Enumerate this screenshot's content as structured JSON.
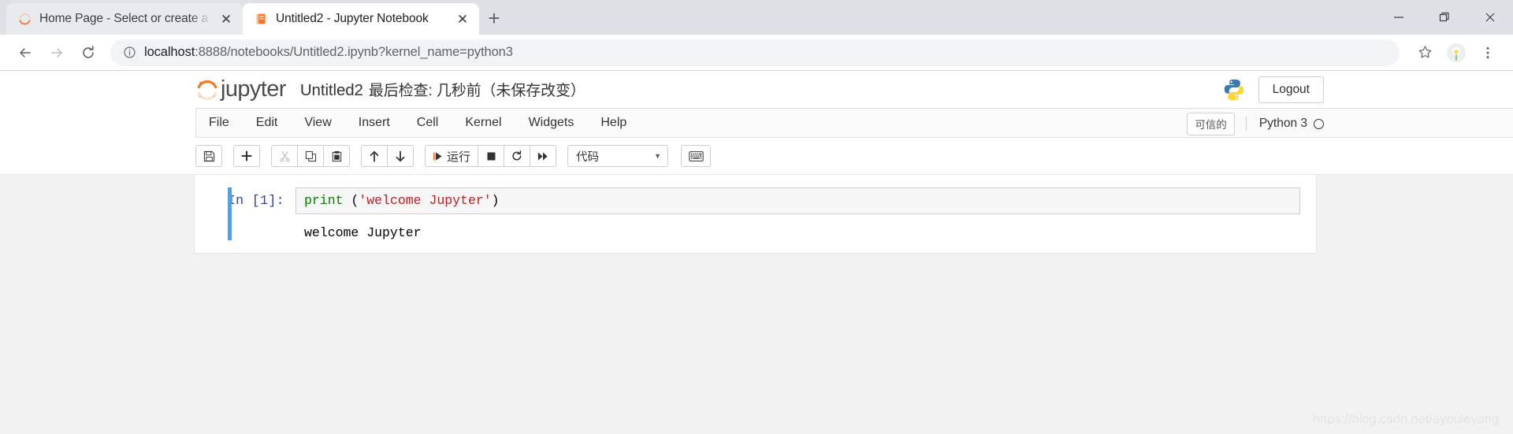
{
  "browser": {
    "tabs": [
      {
        "title": "Home Page - Select or create a",
        "favicon": "jupyter-icon",
        "active": false,
        "close_label": "✕"
      },
      {
        "title": "Untitled2 - Jupyter Notebook",
        "favicon": "notebook-icon",
        "active": true,
        "close_label": "✕"
      }
    ],
    "new_tab_label": "+",
    "window_controls": {
      "minimize": "—",
      "restore": "❐",
      "close": "✕"
    },
    "nav": {
      "back": "←",
      "forward": "→",
      "reload": "↻"
    },
    "omnibox": {
      "info_icon": "info-circle-icon",
      "url_host": "localhost",
      "url_path": ":8888/notebooks/Untitled2.ipynb?kernel_name=python3"
    },
    "toolbar_right": {
      "bookmark": "☆",
      "profile": "flower-avatar-icon",
      "menu": "⋮"
    }
  },
  "jupyter": {
    "logo_text": "jupyter",
    "notebook_name": "Untitled2",
    "checkpoint_text": "最后检查: 几秒前（未保存改变）",
    "logout_label": "Logout",
    "menus": [
      "File",
      "Edit",
      "View",
      "Insert",
      "Cell",
      "Kernel",
      "Widgets",
      "Help"
    ],
    "trusted_label": "可信的",
    "kernel_name": "Python 3",
    "toolbar": {
      "save": "💾",
      "insert_below": "✚",
      "cut": "✂",
      "copy": "⧉",
      "paste": "▤",
      "move_up": "↑",
      "move_down": "↓",
      "run_icon": "▶|",
      "run_label": "运行",
      "stop": "■",
      "restart": "↻",
      "restart_run_all": "▶▶",
      "cell_type": "代码",
      "cell_type_caret": "▼",
      "command_palette": "⌨"
    },
    "cells": [
      {
        "prompt": "In  [1]:",
        "code_tokens": [
          {
            "text": "print ",
            "type": "fn"
          },
          {
            "text": "(",
            "type": "paren"
          },
          {
            "text": "'welcome Jupyter'",
            "type": "str"
          },
          {
            "text": ")",
            "type": "paren"
          }
        ],
        "output": "welcome Jupyter"
      }
    ]
  },
  "watermark": "https://blog.csdn.net/ayouleyang"
}
